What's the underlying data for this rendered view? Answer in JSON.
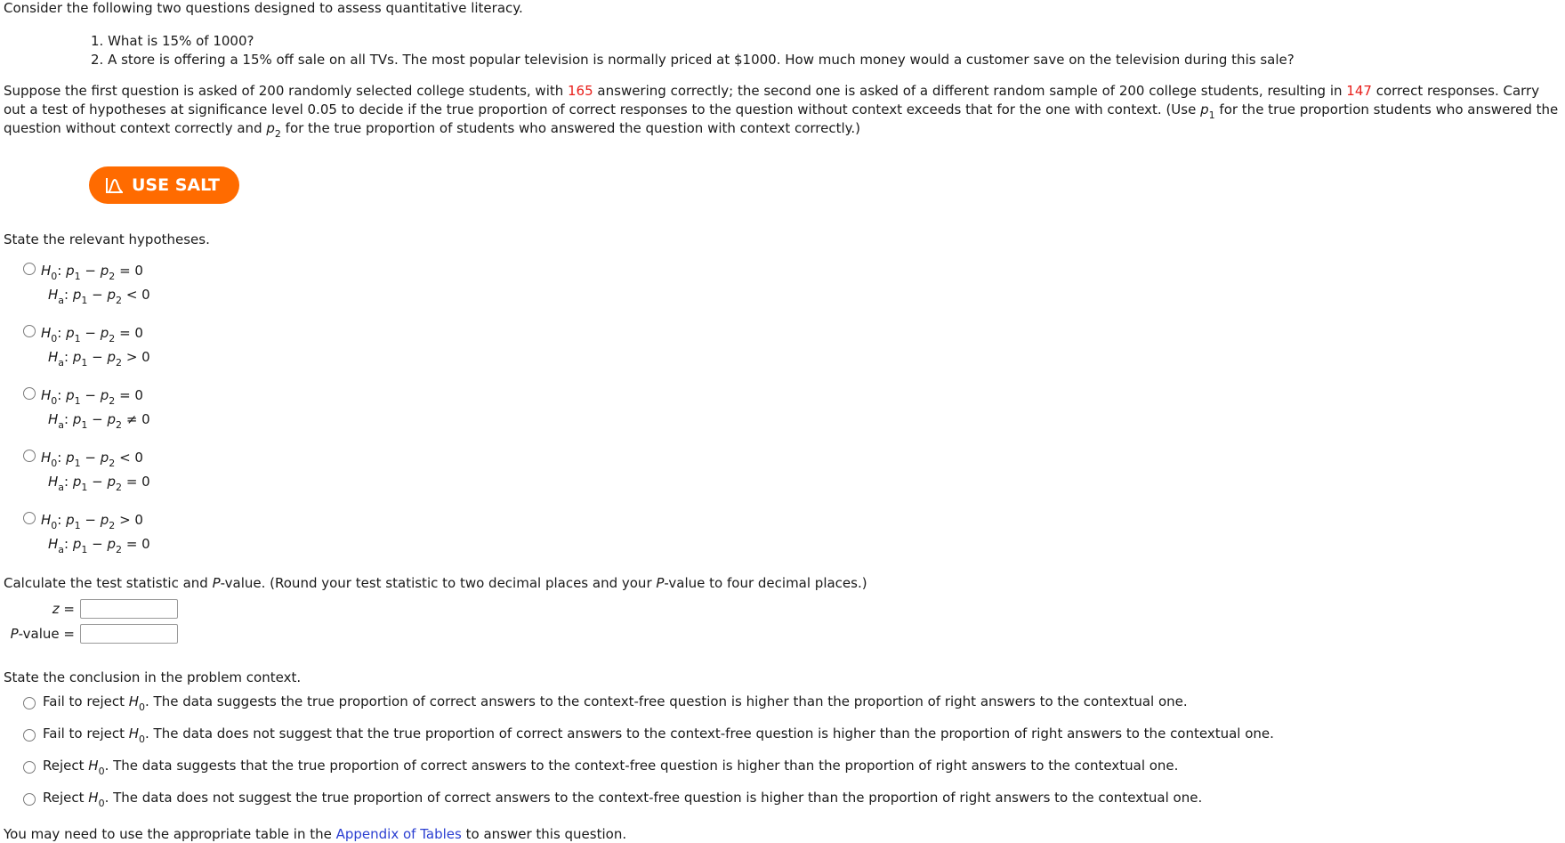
{
  "intro": "Consider the following two questions designed to assess quantitative literacy.",
  "questions": [
    "1. What is 15% of 1000?",
    "2. A store is offering a 15% off sale on all TVs. The most popular television is normally priced at $1000. How much money would a customer save on the television during this sale?"
  ],
  "problem": {
    "part1": "Suppose the first question is asked of 200 randomly selected college students, with ",
    "count1": "165",
    "part2": " answering correctly; the second one is asked of a different random sample of 200 college students, resulting in ",
    "count2": "147",
    "part3": " correct responses. Carry out a test of hypotheses at significance level 0.05 to decide if the true proportion of correct responses to the question without context exceeds that for the one with context. (Use ",
    "p1_var": "p",
    "p1_sub": "1",
    "part4": " for the true proportion students who answered the question without context correctly and ",
    "p2_var": "p",
    "p2_sub": "2",
    "part5": " for the true proportion of students who answered the question with context correctly.)"
  },
  "salt_button": {
    "label": "USE SALT",
    "color": "#ff6b00"
  },
  "hypotheses": {
    "label": "State the relevant hypotheses.",
    "options": [
      {
        "h0_op": "=",
        "h0_rhs": "0",
        "ha_op": "<",
        "ha_rhs": "0"
      },
      {
        "h0_op": "=",
        "h0_rhs": "0",
        "ha_op": ">",
        "ha_rhs": "0"
      },
      {
        "h0_op": "=",
        "h0_rhs": "0",
        "ha_op": "≠",
        "ha_rhs": "0"
      },
      {
        "h0_op": "<",
        "h0_rhs": "0",
        "ha_op": "=",
        "ha_rhs": "0"
      },
      {
        "h0_op": ">",
        "h0_rhs": "0",
        "ha_op": "=",
        "ha_rhs": "0"
      }
    ]
  },
  "calc": {
    "label_pre": "Calculate the test statistic and ",
    "label_p": "P",
    "label_mid": "-value. (Round your test statistic to two decimal places and your ",
    "label_p2": "P",
    "label_post": "-value to four decimal places.)",
    "z_label": "z",
    "pvalue_label_p": "P",
    "pvalue_label_rest": "-value",
    "equals": "=",
    "z_value": "",
    "pvalue_value": ""
  },
  "conclusion": {
    "label": "State the conclusion in the problem context.",
    "options": [
      {
        "prefix": "Fail to reject ",
        "text": ". The data suggests the true proportion of correct answers to the context-free question is higher than the proportion of right answers to the contextual one."
      },
      {
        "prefix": "Fail to reject ",
        "text": ". The data does not suggest that the true proportion of correct answers to the context-free question is higher than the proportion of right answers to the contextual one."
      },
      {
        "prefix": "Reject ",
        "text": ". The data suggests that the true proportion of correct answers to the context-free question is higher than the proportion of right answers to the contextual one."
      },
      {
        "prefix": "Reject ",
        "text": ". The data does not suggest the true proportion of correct answers to the context-free question is higher than the proportion of right answers to the contextual one."
      }
    ]
  },
  "hint": {
    "pre": "You may need to use the appropriate table in the ",
    "link": "Appendix of Tables",
    "post": " to answer this question."
  },
  "colors": {
    "highlight": "#e8201c",
    "link": "#2b3fd1"
  }
}
